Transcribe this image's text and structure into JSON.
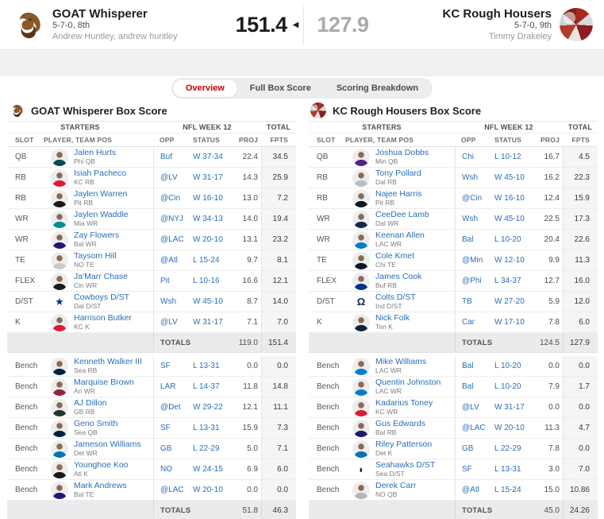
{
  "matchup": {
    "divider_arrow": "◀",
    "home": {
      "name": "GOAT Whisperer",
      "record": "5-7-0, 8th",
      "owner": "Andrew Huntley, andrew huntley",
      "score": "151.4"
    },
    "away": {
      "name": "KC Rough Housers",
      "record": "5-7-0, 9th",
      "owner": "Timmy Drakeley",
      "score": "127.9"
    }
  },
  "tabs": [
    {
      "label": "Overview",
      "active": true
    },
    {
      "label": "Full Box Score",
      "active": false
    },
    {
      "label": "Scoring Breakdown",
      "active": false
    }
  ],
  "table_headers": {
    "starters_group": "STARTERS",
    "week_group": "NFL WEEK 12",
    "total_group": "TOTAL",
    "slot": "SLOT",
    "player": "PLAYER, TEAM POS",
    "opp": "OPP",
    "status": "STATUS",
    "proj": "PROJ",
    "fpts": "FPTS",
    "totals_label": "TOTALS"
  },
  "colors": {
    "accent_red": "#cc0000",
    "link_blue": "#2a6ebb",
    "winner_score": "#1c1c1c",
    "loser_score": "#a8aaac"
  },
  "box_scores": [
    {
      "title": "GOAT Whisperer Box Score",
      "starters": [
        {
          "slot": "QB",
          "player": "Jalen Hurts",
          "team_pos": "Phi  QB",
          "opp": "Buf",
          "status": "W 37-34",
          "proj": "22.4",
          "fpts": "34.5",
          "avatar": "#004C54"
        },
        {
          "slot": "RB",
          "player": "Isiah Pacheco",
          "team_pos": "KC  RB",
          "opp": "@LV",
          "status": "W 31-17",
          "proj": "14.3",
          "fpts": "25.9",
          "avatar": "#E31837"
        },
        {
          "slot": "RB",
          "player": "Jaylen Warren",
          "team_pos": "Pit  RB",
          "opp": "@Cin",
          "status": "W 16-10",
          "proj": "13.0",
          "fpts": "7.2",
          "avatar": "#1a1a1a"
        },
        {
          "slot": "WR",
          "player": "Jaylen Waddle",
          "team_pos": "Mia  WR",
          "opp": "@NYJ",
          "status": "W 34-13",
          "proj": "14.0",
          "fpts": "19.4",
          "avatar": "#008E97"
        },
        {
          "slot": "WR",
          "player": "Zay Flowers",
          "team_pos": "Bal  WR",
          "opp": "@LAC",
          "status": "W 20-10",
          "proj": "13.1",
          "fpts": "23.2",
          "avatar": "#241773"
        },
        {
          "slot": "TE",
          "player": "Taysom Hill",
          "team_pos": "NO  TE",
          "opp": "@Atl",
          "status": "L 15-24",
          "proj": "9.7",
          "fpts": "8.1",
          "avatar": "#c9c9c9"
        },
        {
          "slot": "FLEX",
          "player": "Ja'Marr Chase",
          "team_pos": "Cin  WR",
          "opp": "Pit",
          "status": "L 10-16",
          "proj": "16.6",
          "fpts": "12.1",
          "avatar": "#1a1a1a"
        },
        {
          "slot": "D/ST",
          "player": "Cowboys D/ST",
          "team_pos": "Dal  D/ST",
          "opp": "Wsh",
          "status": "W 45-10",
          "proj": "8.7",
          "fpts": "14.0",
          "avatar": "#003594",
          "glyph": "★"
        },
        {
          "slot": "K",
          "player": "Harrison Butker",
          "team_pos": "KC  K",
          "opp": "@LV",
          "status": "W 31-17",
          "proj": "7.1",
          "fpts": "7.0",
          "avatar": "#E31837"
        }
      ],
      "starters_totals": {
        "proj": "119.0",
        "fpts": "151.4"
      },
      "bench": [
        {
          "slot": "Bench",
          "player": "Kenneth Walker III",
          "team_pos": "Sea  RB",
          "opp": "SF",
          "status": "L 13-31",
          "proj": "0.0",
          "fpts": "0.0",
          "avatar": "#002244"
        },
        {
          "slot": "Bench",
          "player": "Marquise Brown",
          "team_pos": "Ari  WR",
          "opp": "LAR",
          "status": "L 14-37",
          "proj": "11.8",
          "fpts": "14.8",
          "avatar": "#97233F"
        },
        {
          "slot": "Bench",
          "player": "AJ Dillon",
          "team_pos": "GB  RB",
          "opp": "@Det",
          "status": "W 29-22",
          "proj": "12.1",
          "fpts": "11.1",
          "avatar": "#203731"
        },
        {
          "slot": "Bench",
          "player": "Geno Smith",
          "team_pos": "Sea  QB",
          "opp": "SF",
          "status": "L 13-31",
          "proj": "15.9",
          "fpts": "7.3",
          "avatar": "#002244"
        },
        {
          "slot": "Bench",
          "player": "Jameson Williams",
          "team_pos": "Det  WR",
          "opp": "GB",
          "status": "L 22-29",
          "proj": "5.0",
          "fpts": "7.1",
          "avatar": "#0076B6"
        },
        {
          "slot": "Bench",
          "player": "Younghoe Koo",
          "team_pos": "Atl  K",
          "opp": "NO",
          "status": "W 24-15",
          "proj": "6.9",
          "fpts": "6.0",
          "avatar": "#1a1a1a"
        },
        {
          "slot": "Bench",
          "player": "Mark Andrews",
          "team_pos": "Bal  TE",
          "opp": "@LAC",
          "status": "W 20-10",
          "proj": "0.0",
          "fpts": "0.0",
          "avatar": "#241773"
        }
      ],
      "bench_totals": {
        "proj": "51.8",
        "fpts": "46.3"
      }
    },
    {
      "title": "KC Rough Housers Box Score",
      "starters": [
        {
          "slot": "QB",
          "player": "Joshua Dobbs",
          "team_pos": "Min  QB",
          "opp": "Chi",
          "status": "L 10-12",
          "proj": "16.7",
          "fpts": "4.5",
          "avatar": "#4F2683"
        },
        {
          "slot": "RB",
          "player": "Tony Pollard",
          "team_pos": "Dal  RB",
          "opp": "Wsh",
          "status": "W 45-10",
          "proj": "16.2",
          "fpts": "22.3",
          "avatar": "#b9bec4"
        },
        {
          "slot": "RB",
          "player": "Najee Harris",
          "team_pos": "Pit  RB",
          "opp": "@Cin",
          "status": "W 16-10",
          "proj": "12.4",
          "fpts": "15.9",
          "avatar": "#101820"
        },
        {
          "slot": "WR",
          "player": "CeeDee Lamb",
          "team_pos": "Dal  WR",
          "opp": "Wsh",
          "status": "W 45-10",
          "proj": "22.5",
          "fpts": "17.3",
          "avatar": "#0d2a52"
        },
        {
          "slot": "WR",
          "player": "Keenan Allen",
          "team_pos": "LAC  WR",
          "opp": "Bal",
          "status": "L 10-20",
          "proj": "20.4",
          "fpts": "22.6",
          "avatar": "#0080C6"
        },
        {
          "slot": "TE",
          "player": "Cole Kmet",
          "team_pos": "Chi  TE",
          "opp": "@Min",
          "status": "W 12-10",
          "proj": "9.9",
          "fpts": "11.3",
          "avatar": "#0B162A"
        },
        {
          "slot": "FLEX",
          "player": "James Cook",
          "team_pos": "Buf  RB",
          "opp": "@Phi",
          "status": "L 34-37",
          "proj": "12.7",
          "fpts": "16.0",
          "avatar": "#00338D"
        },
        {
          "slot": "D/ST",
          "player": "Colts D/ST",
          "team_pos": "Ind  D/ST",
          "opp": "TB",
          "status": "W 27-20",
          "proj": "5.9",
          "fpts": "12.0",
          "avatar": "#002C5F",
          "glyph": "Ω"
        },
        {
          "slot": "K",
          "player": "Nick Folk",
          "team_pos": "Ten  K",
          "opp": "Car",
          "status": "W 17-10",
          "proj": "7.8",
          "fpts": "6.0",
          "avatar": "#0C2340"
        }
      ],
      "starters_totals": {
        "proj": "124.5",
        "fpts": "127.9"
      },
      "bench": [
        {
          "slot": "Bench",
          "player": "Mike Williams",
          "team_pos": "LAC  WR",
          "opp": "Bal",
          "status": "L 10-20",
          "proj": "0.0",
          "fpts": "0.0",
          "avatar": "#0080C6"
        },
        {
          "slot": "Bench",
          "player": "Quentin Johnston",
          "team_pos": "LAC  WR",
          "opp": "Bal",
          "status": "L 10-20",
          "proj": "7.9",
          "fpts": "1.7",
          "avatar": "#0080C6"
        },
        {
          "slot": "Bench",
          "player": "Kadarius Toney",
          "team_pos": "KC  WR",
          "opp": "@LV",
          "status": "W 31-17",
          "proj": "0.0",
          "fpts": "0.0",
          "avatar": "#E31837"
        },
        {
          "slot": "Bench",
          "player": "Gus Edwards",
          "team_pos": "Bal  RB",
          "opp": "@LAC",
          "status": "W 20-10",
          "proj": "11.3",
          "fpts": "4.7",
          "avatar": "#241773"
        },
        {
          "slot": "Bench",
          "player": "Riley Patterson",
          "team_pos": "Det  K",
          "opp": "GB",
          "status": "L 22-29",
          "proj": "7.8",
          "fpts": "0.0",
          "avatar": "#0076B6"
        },
        {
          "slot": "Bench",
          "player": "Seahawks D/ST",
          "team_pos": "Sea  D/ST",
          "opp": "SF",
          "status": "L 13-31",
          "proj": "3.0",
          "fpts": "7.0",
          "avatar": "#002244",
          "glyph": "◗"
        },
        {
          "slot": "Bench",
          "player": "Derek Carr",
          "team_pos": "NO  QB",
          "opp": "@Atl",
          "status": "L 15-24",
          "proj": "15.0",
          "fpts": "10.86",
          "avatar": "#b5b5b5"
        }
      ],
      "bench_totals": {
        "proj": "45.0",
        "fpts": "24.26"
      }
    }
  ]
}
